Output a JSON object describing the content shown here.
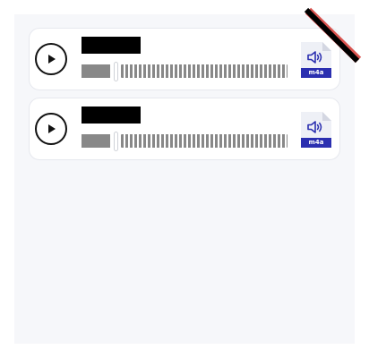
{
  "player": {
    "cards": [
      {
        "title": "",
        "progress_percent": 14,
        "file": {
          "extension": "m4a",
          "icon": "speaker-icon"
        }
      },
      {
        "title": "",
        "progress_percent": 14,
        "file": {
          "extension": "m4a",
          "icon": "speaker-icon"
        }
      }
    ]
  },
  "colors": {
    "panel_bg": "#f6f7fa",
    "card_bg": "#ffffff",
    "redaction": "#000000",
    "waveform": "#888888",
    "file_badge": "#2b2fb0",
    "speaker": "#2b2fb0",
    "close_stroke": "#000000",
    "close_accent": "#d9534f"
  },
  "icons": {
    "play": "play-icon",
    "close": "close-icon",
    "file": "audio-file-icon"
  }
}
